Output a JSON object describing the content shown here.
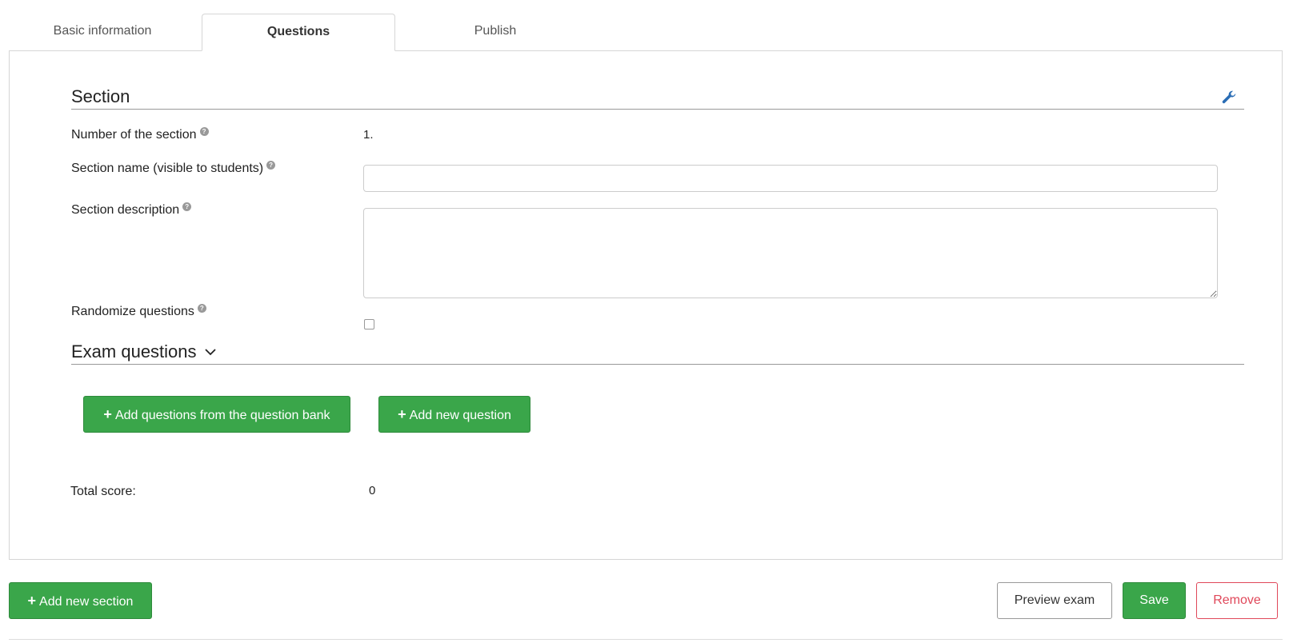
{
  "tabs": [
    {
      "label": "Basic information",
      "active": false
    },
    {
      "label": "Questions",
      "active": true
    },
    {
      "label": "Publish",
      "active": false
    }
  ],
  "section": {
    "title": "Section",
    "wrench_icon": "wrench-icon",
    "number_label": "Number of the section",
    "number_value": "1.",
    "name_label": "Section name (visible to students)",
    "name_value": "",
    "description_label": "Section description",
    "description_value": "",
    "randomize_label": "Randomize questions",
    "randomize_checked": false
  },
  "exam_questions": {
    "title": "Exam questions",
    "add_from_bank_label": "Add questions from the question bank",
    "add_new_question_label": "Add new question"
  },
  "total": {
    "label": "Total score:",
    "value": "0"
  },
  "footer": {
    "add_section_label": "Add new section",
    "preview_label": "Preview exam",
    "save_label": "Save",
    "remove_label": "Remove"
  },
  "colors": {
    "green": "#3aa64a",
    "red": "#e0485a",
    "wrench_blue": "#2a6db5"
  }
}
